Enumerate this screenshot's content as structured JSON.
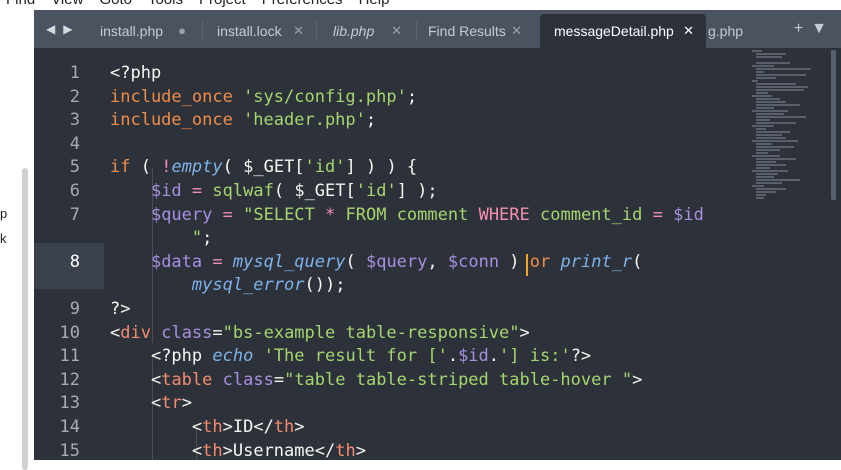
{
  "menubar": [
    "Find",
    "View",
    "Goto",
    "Tools",
    "Project",
    "Preferences",
    "Help"
  ],
  "left_window": {
    "text_1": "p",
    "text_2": "k"
  },
  "tabs": [
    {
      "label": "install.php",
      "control": "●",
      "active": false,
      "italic": false
    },
    {
      "label": "install.lock",
      "control": "✕",
      "active": false,
      "italic": false
    },
    {
      "label": "lib.php",
      "control": "✕",
      "active": false,
      "italic": true
    },
    {
      "label": "Find Results",
      "control": "✕",
      "active": false,
      "italic": false
    },
    {
      "label": "messageDetail.php",
      "control": "✕",
      "active": true,
      "italic": false
    },
    {
      "label": "g.php",
      "control": "",
      "active": false,
      "italic": false
    }
  ],
  "tab_nav": {
    "left": "◀",
    "right": "▶"
  },
  "tab_actions": {
    "add": "+",
    "menu": "▼"
  },
  "line_numbers": [
    "1",
    "2",
    "3",
    "4",
    "5",
    "6",
    "7",
    "",
    "8",
    "",
    "9",
    "10",
    "11",
    "12",
    "13",
    "14",
    "15"
  ],
  "code_lines": [
    [
      {
        "c": "p",
        "t": "<?php"
      }
    ],
    [
      {
        "c": "k",
        "t": "include_once "
      },
      {
        "c": "s",
        "t": "'sys/config.php'"
      },
      {
        "c": "p",
        "t": ";"
      }
    ],
    [
      {
        "c": "k",
        "t": "include_once "
      },
      {
        "c": "s",
        "t": "'header.php'"
      },
      {
        "c": "p",
        "t": ";"
      }
    ],
    [],
    [
      {
        "c": "k",
        "t": "if"
      },
      {
        "c": "p",
        "t": " ( "
      },
      {
        "c": "r",
        "t": "!"
      },
      {
        "c": "f",
        "t": "empty"
      },
      {
        "c": "p",
        "t": "( "
      },
      {
        "c": "p",
        "t": "$_GET["
      },
      {
        "c": "s",
        "t": "'id'"
      },
      {
        "c": "p",
        "t": "] ) ) {"
      }
    ],
    [
      {
        "c": "w",
        "t": "    "
      },
      {
        "c": "a",
        "t": "$id"
      },
      {
        "c": "p",
        "t": " "
      },
      {
        "c": "r",
        "t": "="
      },
      {
        "c": "p",
        "t": " "
      },
      {
        "c": "s",
        "t": "sqlwaf"
      },
      {
        "c": "p",
        "t": "( $_GET["
      },
      {
        "c": "s",
        "t": "'id'"
      },
      {
        "c": "p",
        "t": "] );"
      }
    ],
    [
      {
        "c": "w",
        "t": "    "
      },
      {
        "c": "a",
        "t": "$query"
      },
      {
        "c": "p",
        "t": " "
      },
      {
        "c": "r",
        "t": "="
      },
      {
        "c": "p",
        "t": " "
      },
      {
        "c": "s",
        "t": "\"SELECT "
      },
      {
        "c": "r",
        "t": "*"
      },
      {
        "c": "s",
        "t": " FROM "
      },
      {
        "c": "s",
        "t": "comment "
      },
      {
        "c": "r",
        "t": "WHERE "
      },
      {
        "c": "s",
        "t": "comment_id "
      },
      {
        "c": "r",
        "t": "="
      },
      {
        "c": "s",
        "t": " "
      },
      {
        "c": "a",
        "t": "$id"
      }
    ],
    [
      {
        "c": "w",
        "t": "        "
      },
      {
        "c": "s",
        "t": "\""
      },
      {
        "c": "p",
        "t": ";"
      }
    ],
    [
      {
        "c": "w",
        "t": "    "
      },
      {
        "c": "a",
        "t": "$data"
      },
      {
        "c": "p",
        "t": " "
      },
      {
        "c": "r",
        "t": "="
      },
      {
        "c": "p",
        "t": " "
      },
      {
        "c": "f",
        "t": "mysql_query"
      },
      {
        "c": "p",
        "t": "( "
      },
      {
        "c": "a",
        "t": "$query"
      },
      {
        "c": "p",
        "t": ", "
      },
      {
        "c": "a",
        "t": "$conn"
      },
      {
        "c": "p",
        "t": " ) "
      },
      {
        "c": "k",
        "t": "or"
      },
      {
        "c": "p",
        "t": " "
      },
      {
        "c": "f",
        "t": "print_r"
      },
      {
        "c": "p",
        "t": "("
      }
    ],
    [
      {
        "c": "w",
        "t": "        "
      },
      {
        "c": "f",
        "t": "mysql_error"
      },
      {
        "c": "p",
        "t": "());"
      }
    ],
    [
      {
        "c": "p",
        "t": "?>"
      }
    ],
    [
      {
        "c": "p",
        "t": "<"
      },
      {
        "c": "t",
        "t": "div"
      },
      {
        "c": "p",
        "t": " "
      },
      {
        "c": "a",
        "t": "class"
      },
      {
        "c": "p",
        "t": "="
      },
      {
        "c": "s",
        "t": "\"bs-example table-responsive\""
      },
      {
        "c": "p",
        "t": ">"
      }
    ],
    [
      {
        "c": "w",
        "t": "    "
      },
      {
        "c": "p",
        "t": "<?php "
      },
      {
        "c": "f",
        "t": "echo"
      },
      {
        "c": "p",
        "t": " "
      },
      {
        "c": "s",
        "t": "'The result for ['"
      },
      {
        "c": "p",
        "t": "."
      },
      {
        "c": "a",
        "t": "$id"
      },
      {
        "c": "p",
        "t": "."
      },
      {
        "c": "s",
        "t": "'] is:'"
      },
      {
        "c": "p",
        "t": "?>"
      }
    ],
    [
      {
        "c": "w",
        "t": "    "
      },
      {
        "c": "p",
        "t": "<"
      },
      {
        "c": "t",
        "t": "table"
      },
      {
        "c": "p",
        "t": " "
      },
      {
        "c": "a",
        "t": "class"
      },
      {
        "c": "p",
        "t": "="
      },
      {
        "c": "s",
        "t": "\"table table-striped table-hover \""
      },
      {
        "c": "p",
        "t": ">"
      }
    ],
    [
      {
        "c": "w",
        "t": "    "
      },
      {
        "c": "p",
        "t": "<"
      },
      {
        "c": "t",
        "t": "tr"
      },
      {
        "c": "p",
        "t": ">"
      }
    ],
    [
      {
        "c": "w",
        "t": "        "
      },
      {
        "c": "p",
        "t": "<"
      },
      {
        "c": "t",
        "t": "th"
      },
      {
        "c": "p",
        "t": ">ID</"
      },
      {
        "c": "t",
        "t": "th"
      },
      {
        "c": "p",
        "t": ">"
      }
    ],
    [
      {
        "c": "w",
        "t": "        "
      },
      {
        "c": "p",
        "t": "<"
      },
      {
        "c": "t",
        "t": "th"
      },
      {
        "c": "p",
        "t": ">Username</"
      },
      {
        "c": "t",
        "t": "th"
      },
      {
        "c": "p",
        "t": ">"
      }
    ]
  ],
  "colors": {
    "editor_bg": "#2c313a",
    "tabbar_bg": "#4b5260",
    "cursor": "#f5a623",
    "string": "#a5d66f",
    "keyword": "#f08d49",
    "function": "#7fb2e8"
  }
}
